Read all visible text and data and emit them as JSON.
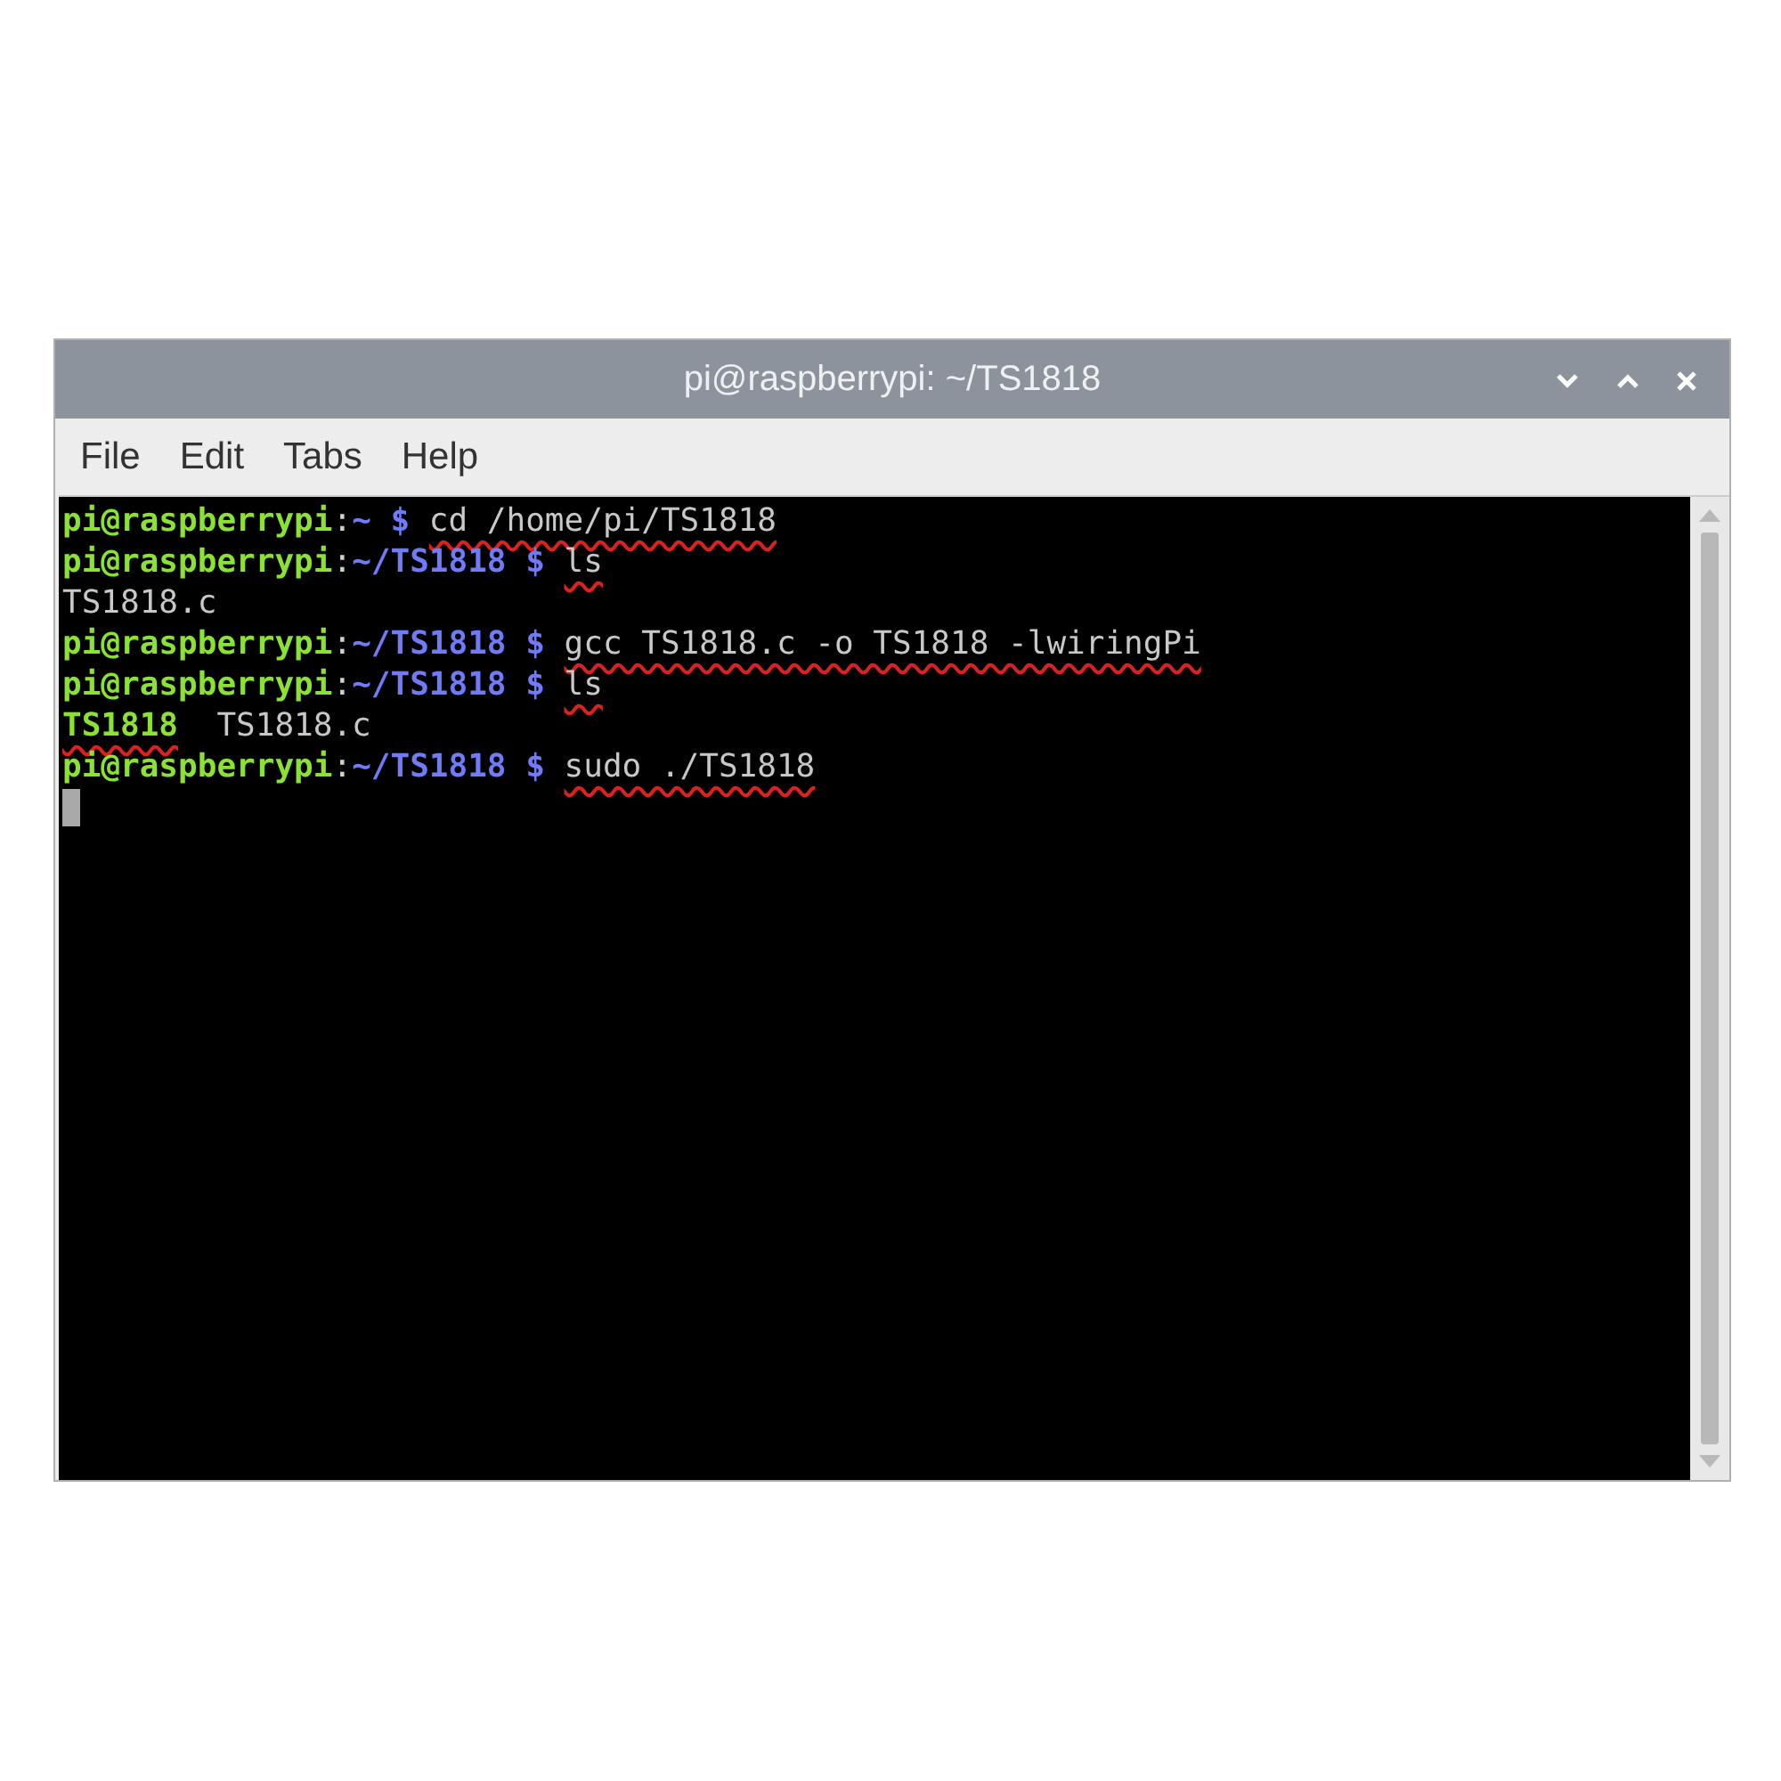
{
  "window": {
    "title": "pi@raspberrypi: ~/TS1818"
  },
  "menu": [
    "File",
    "Edit",
    "Tabs",
    "Help"
  ],
  "terminal": {
    "lines": [
      {
        "segments": [
          {
            "kind": "user",
            "text": "pi@raspberrypi"
          },
          {
            "kind": "colon",
            "text": ":"
          },
          {
            "kind": "path",
            "text": "~"
          },
          {
            "kind": "dollar",
            "text": "$"
          },
          {
            "kind": "command",
            "text": "cd /home/pi/TS1818",
            "underlined": true
          }
        ]
      },
      {
        "segments": [
          {
            "kind": "user",
            "text": "pi@raspberrypi"
          },
          {
            "kind": "colon",
            "text": ":"
          },
          {
            "kind": "path",
            "text": "~/TS1818"
          },
          {
            "kind": "dollar",
            "text": "$"
          },
          {
            "kind": "command",
            "text": "ls",
            "underlined": true
          }
        ]
      },
      {
        "segments": [
          {
            "kind": "output",
            "text": "TS1818.c",
            "underlined": false
          }
        ]
      },
      {
        "segments": [
          {
            "kind": "user",
            "text": "pi@raspberrypi"
          },
          {
            "kind": "colon",
            "text": ":"
          },
          {
            "kind": "path",
            "text": "~/TS1818"
          },
          {
            "kind": "dollar",
            "text": "$"
          },
          {
            "kind": "command",
            "text": "gcc TS1818.c -o TS1818 -lwiringPi",
            "underlined": true
          }
        ]
      },
      {
        "segments": [
          {
            "kind": "user",
            "text": "pi@raspberrypi"
          },
          {
            "kind": "colon",
            "text": ":"
          },
          {
            "kind": "path",
            "text": "~/TS1818"
          },
          {
            "kind": "dollar",
            "text": "$"
          },
          {
            "kind": "command",
            "text": "ls",
            "underlined": true
          }
        ]
      },
      {
        "segments": [
          {
            "kind": "executable",
            "text": "TS1818",
            "underlined": true
          },
          {
            "kind": "output",
            "text": "TS1818.c",
            "underlined": false
          }
        ]
      },
      {
        "segments": [
          {
            "kind": "user",
            "text": "pi@raspberrypi"
          },
          {
            "kind": "colon",
            "text": ":"
          },
          {
            "kind": "path",
            "text": "~/TS1818"
          },
          {
            "kind": "dollar",
            "text": "$"
          },
          {
            "kind": "command",
            "text": "sudo ./TS1818",
            "underlined": true
          }
        ]
      }
    ]
  }
}
